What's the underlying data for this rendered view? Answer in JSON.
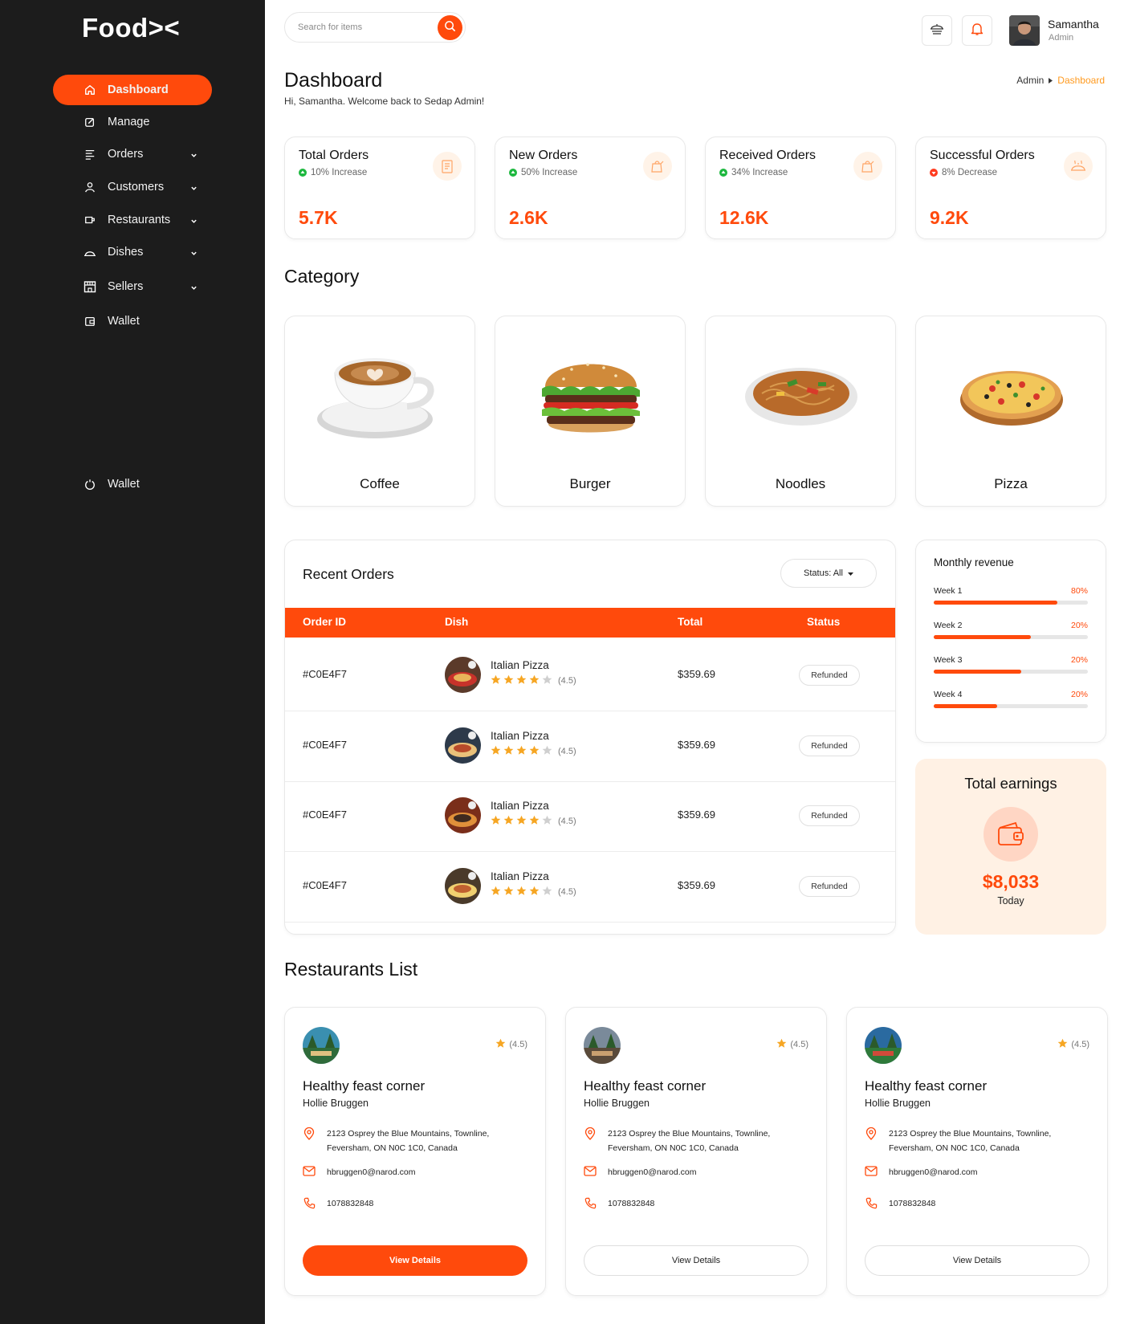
{
  "app": {
    "logo": "Food><"
  },
  "sidebar": {
    "items": [
      {
        "label": "Dashboard",
        "icon": "home-icon",
        "active": true
      },
      {
        "label": "Manage",
        "icon": "edit-icon"
      },
      {
        "label": "Orders",
        "icon": "list-icon",
        "expandable": true
      },
      {
        "label": "Customers",
        "icon": "user-icon",
        "expandable": true
      },
      {
        "label": "Restaurants",
        "icon": "cup-icon",
        "expandable": true
      },
      {
        "label": "Dishes",
        "icon": "cloche-icon",
        "expandable": true
      },
      {
        "label": "Sellers",
        "icon": "store-icon",
        "expandable": true
      },
      {
        "label": "Wallet",
        "icon": "wallet-icon"
      }
    ],
    "bottom": {
      "label": "Wallet",
      "icon": "power-icon"
    }
  },
  "topbar": {
    "search_placeholder": "Search for items",
    "user": {
      "name": "Samantha",
      "role": "Admin"
    }
  },
  "header": {
    "title": "Dashboard",
    "welcome": "Hi, Samantha. Welcome back  to Sedap Admin!",
    "breadcrumb": {
      "parent": "Admin",
      "current": "Dashboard"
    }
  },
  "stats": [
    {
      "title": "Total Orders",
      "delta": "10% Increase",
      "trend": "up",
      "value": "5.7K"
    },
    {
      "title": "New Orders",
      "delta": "50% Increase",
      "trend": "up",
      "value": "2.6K"
    },
    {
      "title": "Received Orders",
      "delta": "34% Increase",
      "trend": "up",
      "value": "12.6K"
    },
    {
      "title": "Successful Orders",
      "delta": "8% Decrease",
      "trend": "down",
      "value": "9.2K"
    }
  ],
  "category": {
    "title": "Category",
    "items": [
      {
        "label": "Coffee"
      },
      {
        "label": "Burger"
      },
      {
        "label": "Noodles"
      },
      {
        "label": "Pizza"
      }
    ]
  },
  "orders": {
    "title": "Recent Orders",
    "filter_label": "Status: All",
    "columns": [
      "Order ID",
      "Dish",
      "Total",
      "Status"
    ],
    "rows": [
      {
        "id": "#C0E4F7",
        "dish": "Italian Pizza",
        "rating": 4,
        "rating_label": "(4.5)",
        "total": "$359.69",
        "status": "Refunded"
      },
      {
        "id": "#C0E4F7",
        "dish": "Italian Pizza",
        "rating": 4,
        "rating_label": "(4.5)",
        "total": "$359.69",
        "status": "Refunded"
      },
      {
        "id": "#C0E4F7",
        "dish": "Italian Pizza",
        "rating": 4,
        "rating_label": "(4.5)",
        "total": "$359.69",
        "status": "Refunded"
      },
      {
        "id": "#C0E4F7",
        "dish": "Italian Pizza",
        "rating": 4,
        "rating_label": "(4.5)",
        "total": "$359.69",
        "status": "Refunded"
      }
    ]
  },
  "revenue": {
    "title": "Monthly revenue",
    "weeks": [
      {
        "label": "Week 1",
        "pct_label": "80%",
        "fill": 0.8
      },
      {
        "label": "Week 2",
        "pct_label": "20%",
        "fill": 0.63
      },
      {
        "label": "Week 3",
        "pct_label": "20%",
        "fill": 0.57
      },
      {
        "label": "Week 4",
        "pct_label": "20%",
        "fill": 0.41
      }
    ]
  },
  "earnings": {
    "title": "Total earnings",
    "value": "$8,033",
    "sub": "Today"
  },
  "restaurants": {
    "title": "Restaurants List",
    "items": [
      {
        "rating": "(4.5)",
        "name": "Healthy feast corner",
        "owner": "Hollie Bruggen",
        "address_1": "2123 Osprey the Blue Mountains, Townline,",
        "address_2": "Feversham, ON N0C 1C0, Canada",
        "email": "hbruggen0@narod.com",
        "phone": "1078832848",
        "button": "View Details",
        "primary": true
      },
      {
        "rating": "(4.5)",
        "name": "Healthy feast corner",
        "owner": "Hollie Bruggen",
        "address_1": "2123 Osprey the Blue Mountains, Townline,",
        "address_2": "Feversham, ON N0C 1C0, Canada",
        "email": "hbruggen0@narod.com",
        "phone": "1078832848",
        "button": "View Details",
        "primary": false
      },
      {
        "rating": "(4.5)",
        "name": "Healthy feast corner",
        "owner": "Hollie Bruggen",
        "address_1": "2123 Osprey the Blue Mountains, Townline,",
        "address_2": "Feversham, ON N0C 1C0, Canada",
        "email": "hbruggen0@narod.com",
        "phone": "1078832848",
        "button": "View Details",
        "primary": false
      }
    ]
  },
  "colors": {
    "accent": "#ff4a0c",
    "sidebar": "#1c1c1c",
    "amber": "#ff9a1f",
    "star": "#f6a623",
    "up": "#1db83f",
    "down": "#ff3b1f"
  }
}
